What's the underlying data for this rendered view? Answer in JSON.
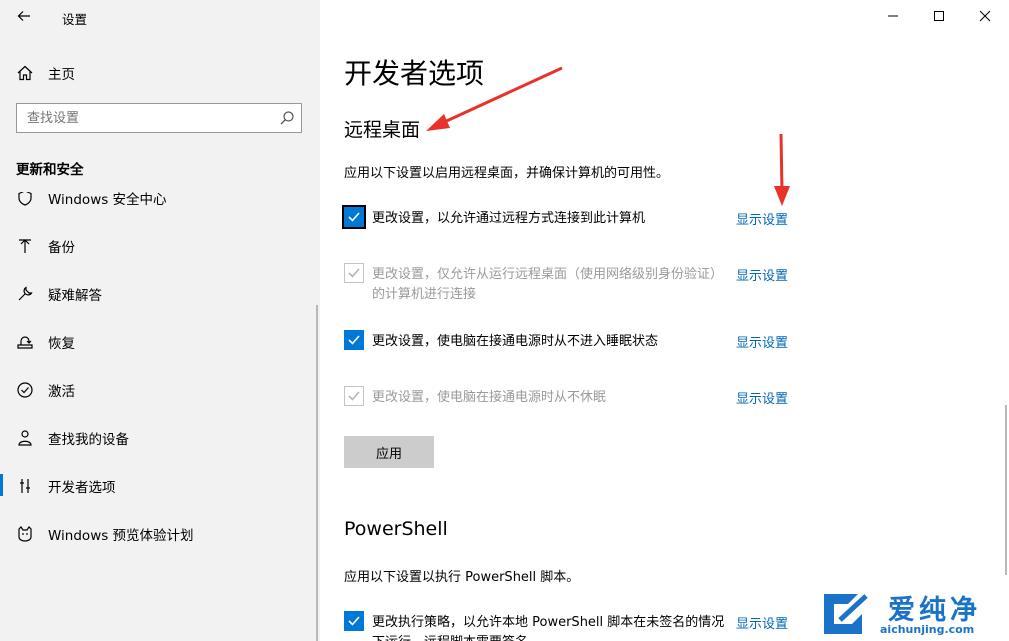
{
  "window": {
    "title": "设置"
  },
  "sidebar": {
    "home_label": "主页",
    "search": {
      "placeholder": "查找设置"
    },
    "section_title": "更新和安全",
    "items": [
      {
        "label": "Windows 安全中心",
        "icon": "shield-icon"
      },
      {
        "label": "备份",
        "icon": "backup-arrow-icon"
      },
      {
        "label": "疑难解答",
        "icon": "wrench-icon"
      },
      {
        "label": "恢复",
        "icon": "recovery-icon"
      },
      {
        "label": "激活",
        "icon": "check-circle-icon"
      },
      {
        "label": "查找我的设备",
        "icon": "person-location-icon"
      },
      {
        "label": "开发者选项",
        "icon": "developer-sliders-icon",
        "active": true
      },
      {
        "label": "Windows 预览体验计划",
        "icon": "insider-cat-icon"
      }
    ]
  },
  "main": {
    "page_title": "开发者选项",
    "remote_desktop": {
      "title": "远程桌面",
      "description": "应用以下设置以启用远程桌面，并确保计算机的可用性。",
      "options": [
        {
          "text": "更改设置，以允许通过远程方式连接到此计算机",
          "checked": true,
          "enabled": true,
          "link": "显示设置"
        },
        {
          "text": "更改设置，仅允许从运行远程桌面（使用网络级别身份验证）的计算机进行连接",
          "checked": true,
          "enabled": false,
          "link": "显示设置"
        },
        {
          "text": "更改设置，使电脑在接通电源时从不进入睡眠状态",
          "checked": true,
          "enabled": true,
          "link": "显示设置"
        },
        {
          "text": "更改设置，使电脑在接通电源时从不休眠",
          "checked": true,
          "enabled": false,
          "link": "显示设置"
        }
      ],
      "apply_label": "应用"
    },
    "powershell": {
      "title": "PowerShell",
      "description": "应用以下设置以执行 PowerShell 脚本。",
      "options": [
        {
          "text": "更改执行策略，以允许本地 PowerShell 脚本在未签名的情况下运行。远程脚本需要签名。",
          "checked": true,
          "enabled": true,
          "link": "显示设置"
        }
      ]
    }
  },
  "watermark": {
    "text": "爱纯净",
    "url": "aichunjing.com"
  },
  "colors": {
    "accent": "#0078d7",
    "link": "#0067b8",
    "annotation_arrow": "#e8322a"
  }
}
